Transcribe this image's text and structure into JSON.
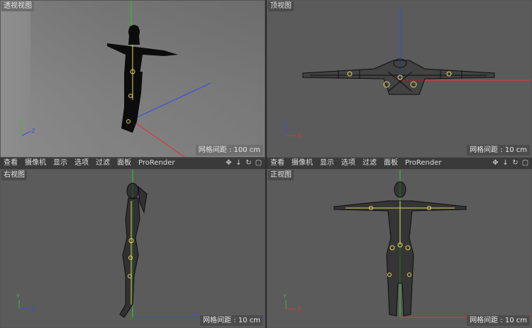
{
  "viewports": {
    "perspective": {
      "title": "透视视图",
      "scale": "网格间距 : 100 cm"
    },
    "top": {
      "title": "顶视图",
      "scale": "网格间距 : 10 cm"
    },
    "right": {
      "title": "右视图",
      "scale": "网格间距 : 10 cm"
    },
    "front": {
      "title": "正视图",
      "scale": "网格间距 : 10 cm"
    }
  },
  "menu": {
    "items": [
      "查看",
      "摄像机",
      "显示",
      "选项",
      "过滤",
      "面板",
      "ProRender"
    ]
  },
  "nav_icons": [
    "move-view-icon",
    "dolly-view-icon",
    "rotate-view-icon",
    "maximize-view-icon"
  ],
  "nav_glyphs": [
    "✥",
    "↓",
    "↻",
    "▢"
  ],
  "axis": {
    "x": "X",
    "y": "Y",
    "z": "Z"
  },
  "colors": {
    "x_axis": "#d23a3a",
    "y_axis": "#3ab83a",
    "z_axis": "#3a4fd8",
    "bone": "#e3d45a"
  }
}
